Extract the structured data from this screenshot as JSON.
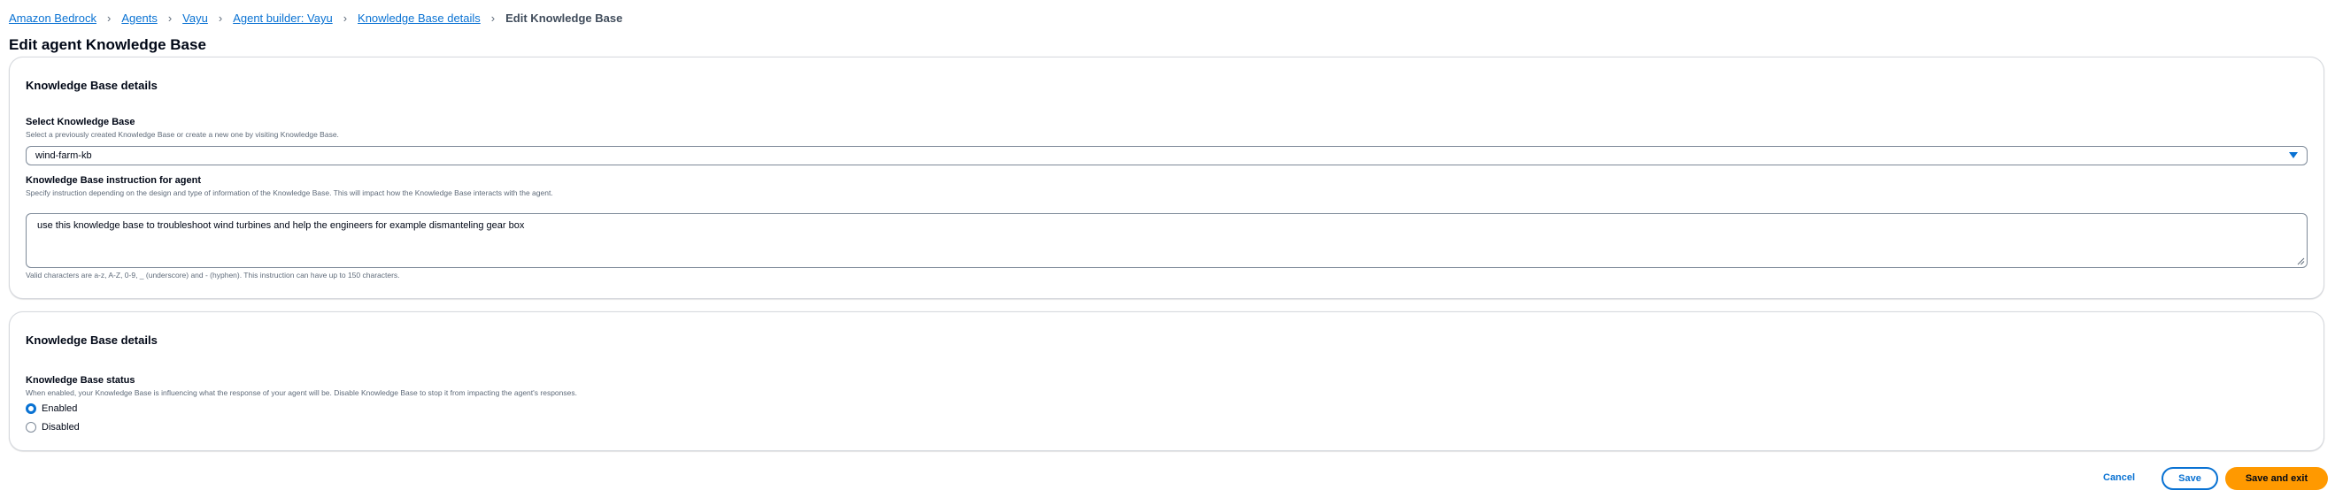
{
  "breadcrumb": {
    "items": [
      {
        "label": "Amazon Bedrock"
      },
      {
        "label": "Agents"
      },
      {
        "label": "Vayu"
      },
      {
        "label": "Agent builder: Vayu"
      },
      {
        "label": "Knowledge Base details"
      }
    ],
    "current": "Edit Knowledge Base"
  },
  "page": {
    "title": "Edit agent Knowledge Base"
  },
  "kb_details": {
    "header": "Knowledge Base details",
    "select": {
      "label": "Select Knowledge Base",
      "description": "Select a previously created Knowledge Base or create a new one by visiting Knowledge Base.",
      "value": "wind-farm-kb"
    },
    "instruction": {
      "label": "Knowledge Base instruction for agent",
      "description": "Specify instruction depending on the design and type of information of the Knowledge Base. This will impact how the Knowledge Base interacts with the agent.",
      "value": "use this knowledge base to troubleshoot wind turbines and help the engineers for example dismanteling gear box",
      "constraint": "Valid characters are a-z, A-Z, 0-9, _ (underscore) and - (hyphen). This instruction can have up to 150 characters."
    }
  },
  "kb_status": {
    "header": "Knowledge Base details",
    "label": "Knowledge Base status",
    "description": "When enabled, your Knowledge Base is influencing what the response of your agent will be. Disable Knowledge Base to stop it from impacting the agent's responses.",
    "options": [
      {
        "label": "Enabled",
        "selected": true
      },
      {
        "label": "Disabled",
        "selected": false
      }
    ]
  },
  "footer": {
    "cancel_label": "Cancel",
    "save_label": "Save",
    "save_exit_label": "Save and exit"
  },
  "colors": {
    "link": "#0972d3",
    "primary_button": "#ff9900",
    "border": "#7d8998"
  },
  "icons": {
    "breadcrumb_separator": "chevron-right-icon",
    "select_caret": "caret-down-icon",
    "textarea_resize": "resize-handle-icon"
  }
}
